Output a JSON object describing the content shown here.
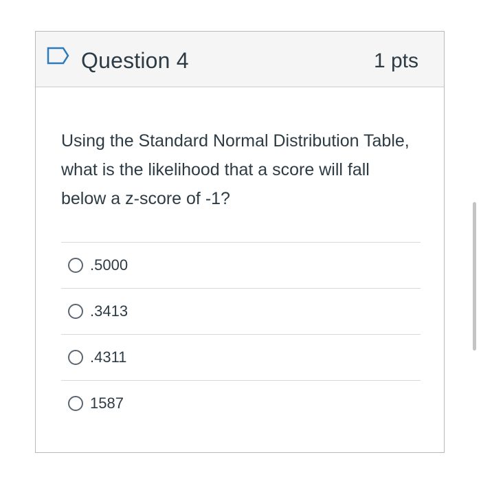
{
  "question": {
    "title": "Question 4",
    "points": "1 pts",
    "flag_icon": "bookmark-flag-icon",
    "text": "Using the Standard Normal Distribution Table, what is the likelihood that a score will fall below a z-score of -1?"
  },
  "answers": [
    {
      "label": ".5000"
    },
    {
      "label": ".3413"
    },
    {
      "label": ".4311"
    },
    {
      "label": "1587"
    }
  ],
  "colors": {
    "header_bg": "#f5f5f5",
    "border": "#b8b8b8",
    "flag": "#2b7abc",
    "text": "#2d3b45"
  }
}
